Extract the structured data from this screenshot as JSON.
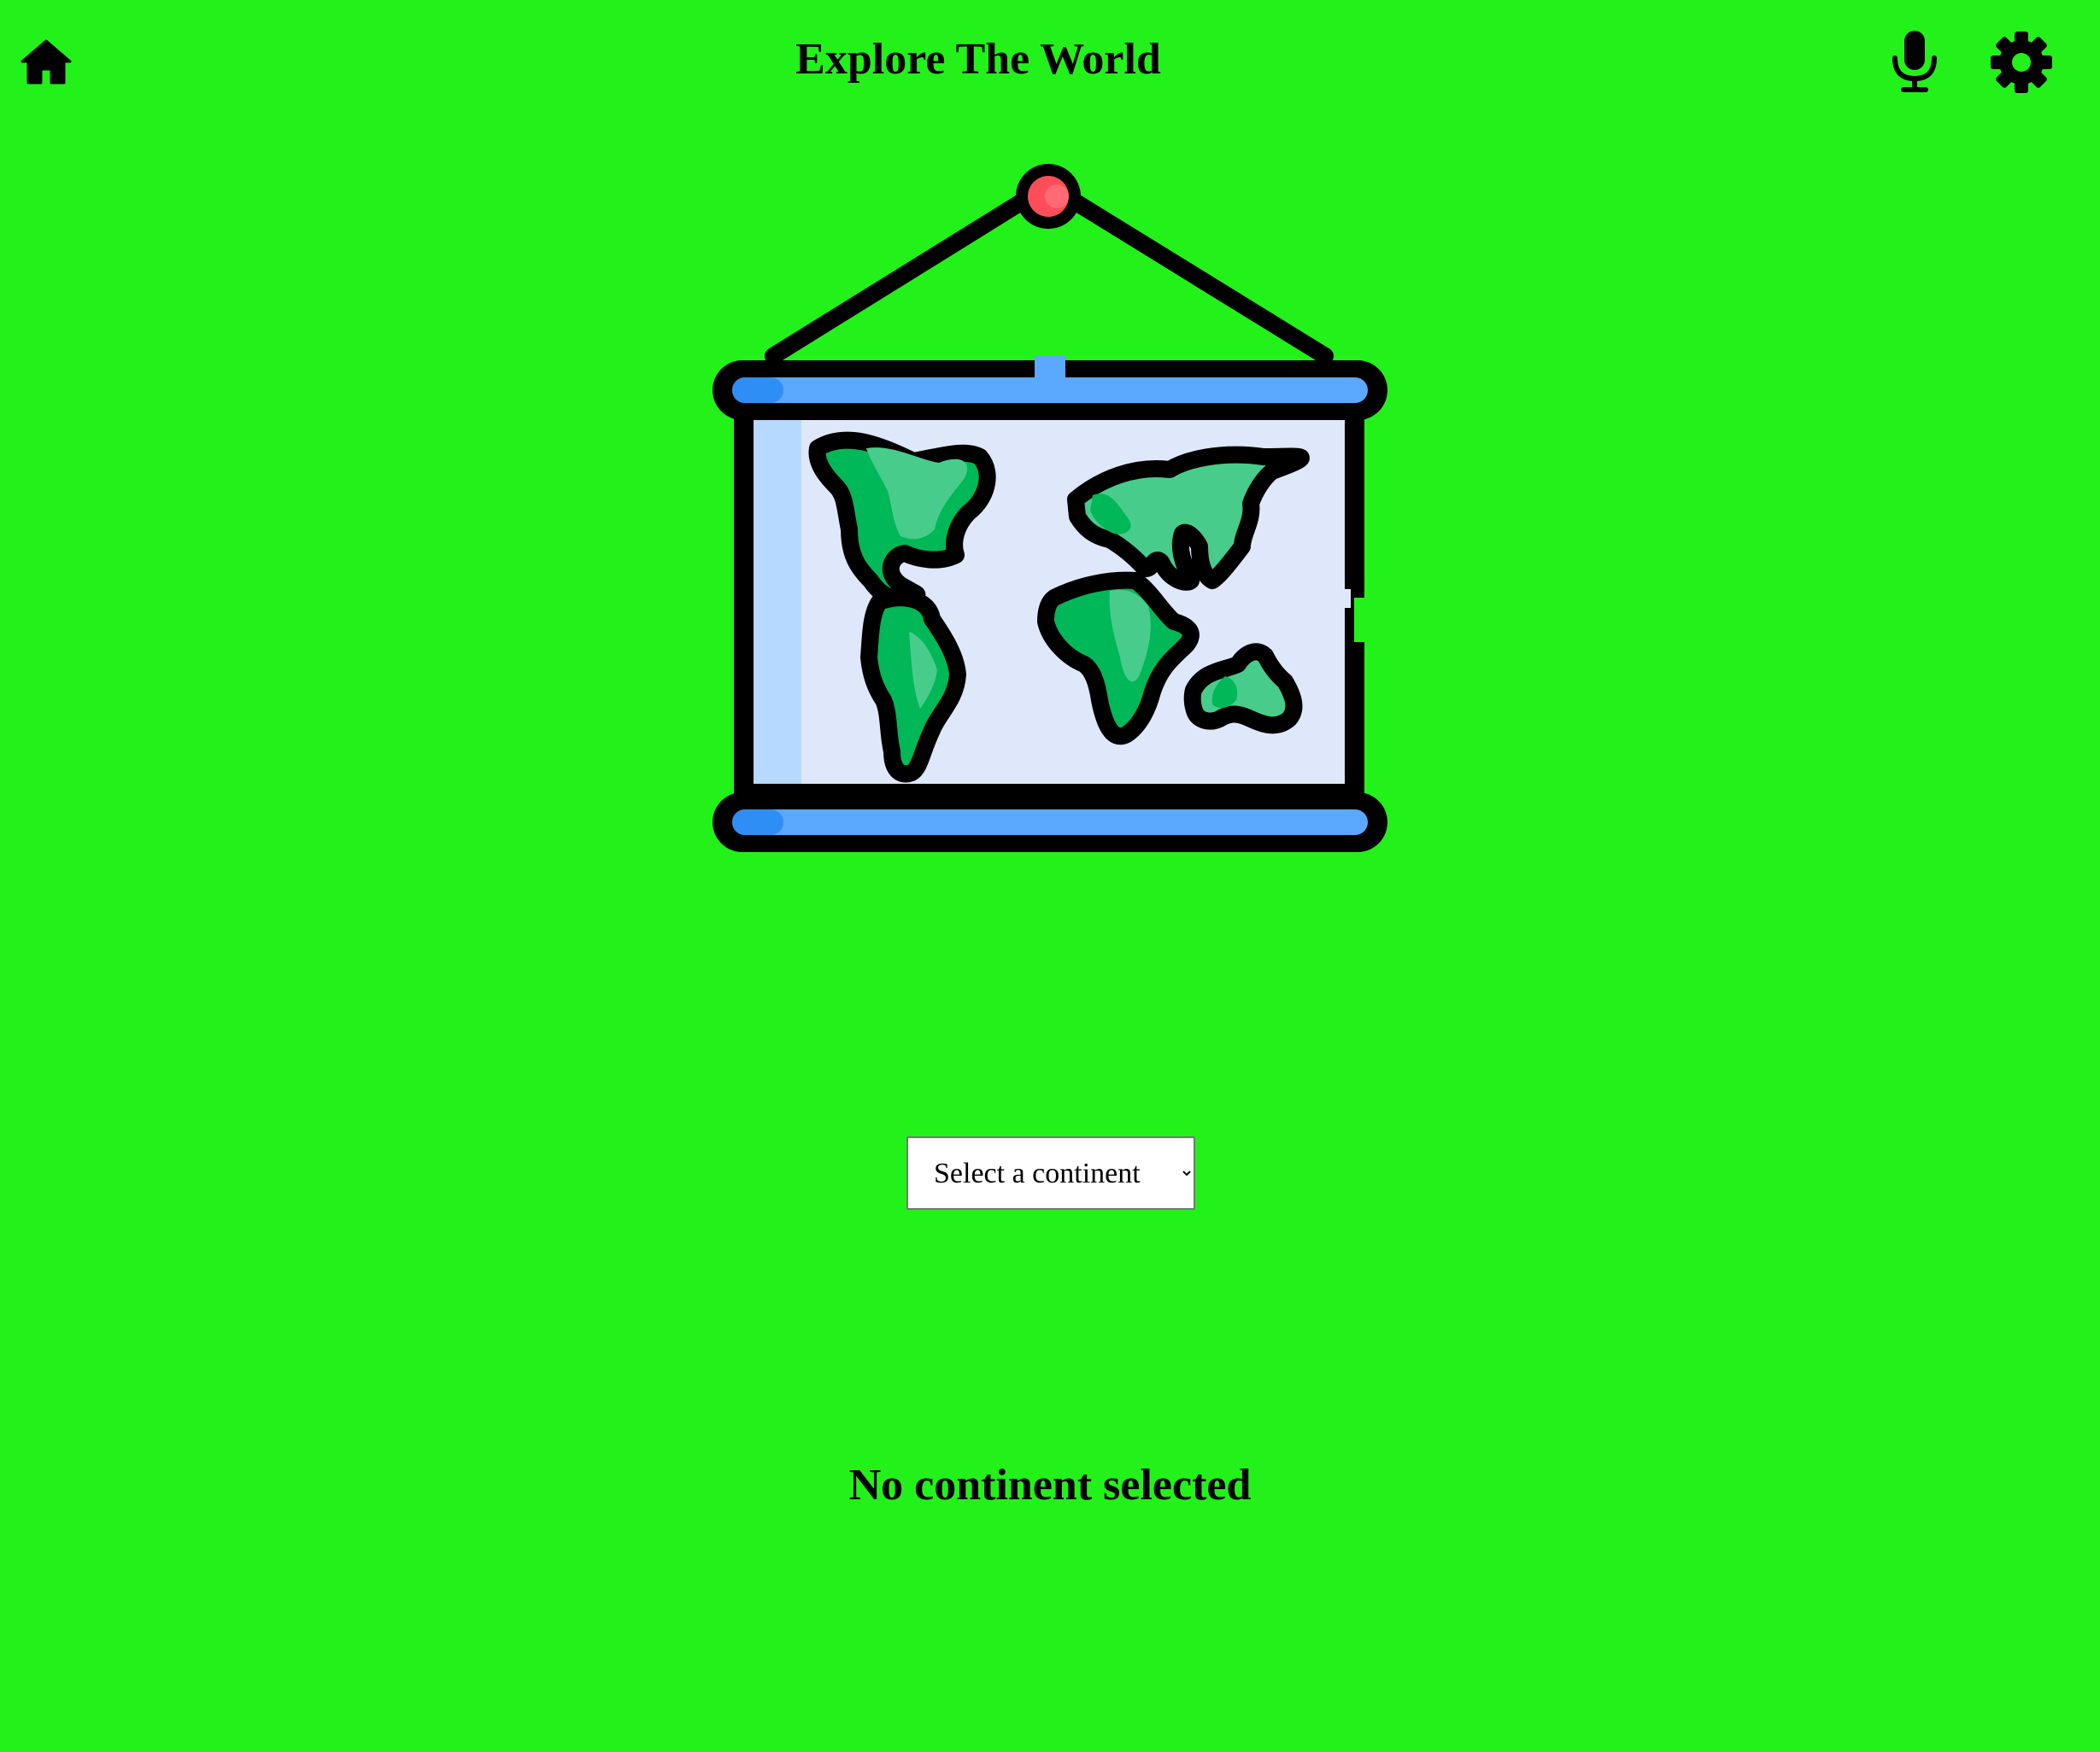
{
  "header": {
    "title": "Explore The World",
    "icons": {
      "home": "home-icon",
      "microphone": "microphone-icon",
      "settings": "gear-icon"
    }
  },
  "continent_select": {
    "selected": "Select a continent",
    "options": [
      "Select a continent"
    ]
  },
  "status": {
    "message": "No continent selected"
  },
  "colors": {
    "background": "#22f21a",
    "map_land": "#00b857",
    "map_land_light": "#48cc8c",
    "map_panel": "#dfe8fb",
    "roller_blue": "#5aa9ff",
    "pin_red": "#ff4d5a"
  }
}
